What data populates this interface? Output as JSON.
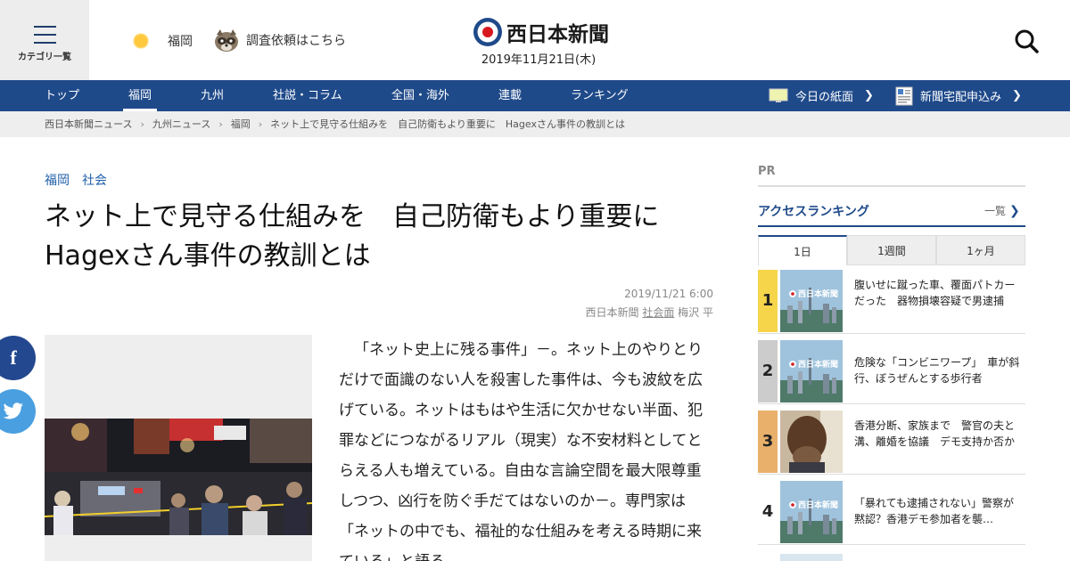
{
  "header": {
    "category_label": "カテゴリ一覧",
    "weather_city": "福岡",
    "request_link": "調査依頼はこちら",
    "logo_text": "西日本新聞",
    "date": "2019年11月21日(木)"
  },
  "nav": {
    "items": [
      "トップ",
      "福岡",
      "九州",
      "社説・コラム",
      "全国・海外",
      "連載",
      "ランキング"
    ],
    "todays_paper": "今日の紙面",
    "subscribe": "新聞宅配申込み"
  },
  "breadcrumb": [
    "西日本新聞ニュース",
    "九州ニュース",
    "福岡",
    "ネット上で見守る仕組みを　自己防衛もより重要に　Hagexさん事件の教訓とは"
  ],
  "article": {
    "tags": [
      "福岡",
      "社会"
    ],
    "title": "ネット上で見守る仕組みを　自己防衛もより重要に　Hagexさん事件の教訓とは",
    "datetime": "2019/11/21 6:00",
    "publisher": "西日本新聞",
    "section": "社会面",
    "author": "梅沢 平",
    "body": "「ネット史上に残る事件」－。ネット上のやりとりだけで面識のない人を殺害した事件は、今も波紋を広げている。ネットはもはや生活に欠かせない半面、犯罪などにつながるリアル（現実）な不安材料としてとらえる人も増えている。自由な言論空間を最大限尊重しつつ、凶行を防ぐ手だてはないのか－。専門家は「ネットの中でも、福祉的な仕組みを考える時期に来ている」と語る。"
  },
  "sidebar": {
    "pr": "PR",
    "ranking_title": "アクセスランキング",
    "ranking_more": "一覧",
    "tabs": [
      "1日",
      "1週間",
      "1ヶ月"
    ],
    "items": [
      {
        "rank": "1",
        "text": "腹いせに蹴った車、覆面パトカーだった　器物損壊容疑で男逮捕",
        "color": "#f6d54a"
      },
      {
        "rank": "2",
        "text": "危険な「コンビニワープ」　車が斜行、ぼうぜんとする歩行者",
        "color": "#cccccc"
      },
      {
        "rank": "3",
        "text": "香港分断、家族まで　警官の夫と溝、離婚を協議　デモ支持か否か",
        "color": "#e8b06a"
      },
      {
        "rank": "4",
        "text": "「暴れても逮捕されない」警察が黙認？香港デモ参加者を襲…",
        "color": "#ffffff"
      }
    ]
  },
  "colors": {
    "nav_bg": "#1f4a8a",
    "accent": "#1f5fa8",
    "facebook": "#23488f",
    "twitter": "#4a9fe0"
  }
}
